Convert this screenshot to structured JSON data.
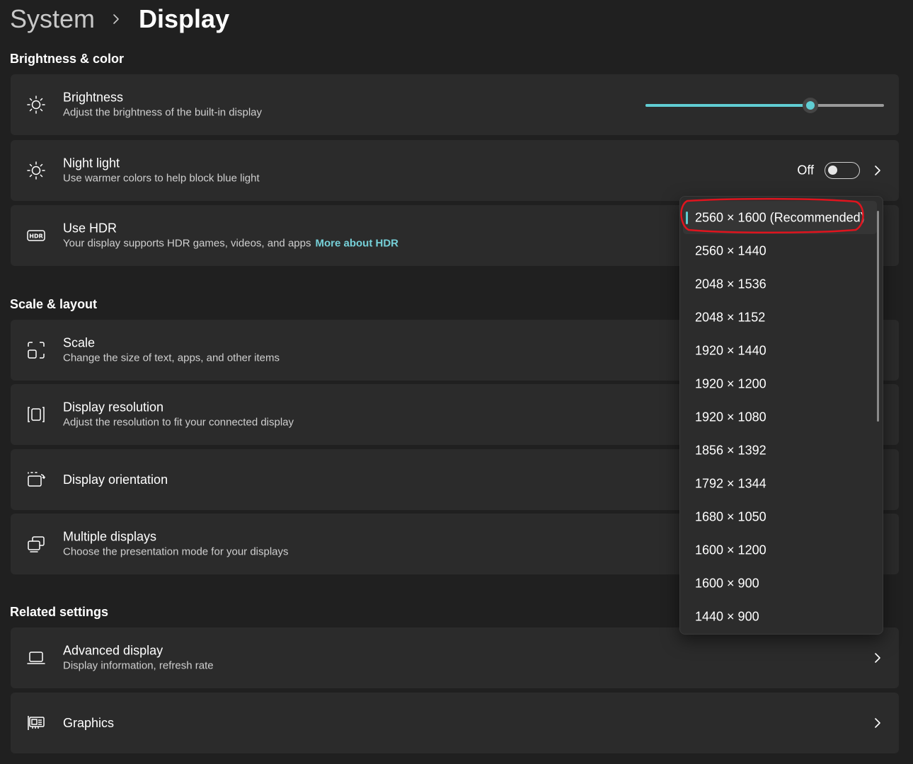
{
  "breadcrumb": {
    "parent": "System",
    "current": "Display"
  },
  "sections": {
    "brightness_color": "Brightness & color",
    "scale_layout": "Scale & layout",
    "related": "Related settings"
  },
  "brightness": {
    "title": "Brightness",
    "subtitle": "Adjust the brightness of the built-in display",
    "value_percent": 69
  },
  "night_light": {
    "title": "Night light",
    "subtitle": "Use warmer colors to help block blue light",
    "state": "Off"
  },
  "hdr": {
    "title": "Use HDR",
    "subtitle": "Your display supports HDR games, videos, and apps",
    "link": "More about HDR"
  },
  "scale": {
    "title": "Scale",
    "subtitle": "Change the size of text, apps, and other items"
  },
  "resolution": {
    "title": "Display resolution",
    "subtitle": "Adjust the resolution to fit your connected display"
  },
  "orientation": {
    "title": "Display orientation"
  },
  "multiple": {
    "title": "Multiple displays",
    "subtitle": "Choose the presentation mode for your displays"
  },
  "advanced": {
    "title": "Advanced display",
    "subtitle": "Display information, refresh rate"
  },
  "graphics": {
    "title": "Graphics"
  },
  "resolution_options": [
    "2560 × 1600 (Recommended)",
    "2560 × 1440",
    "2048 × 1536",
    "2048 × 1152",
    "1920 × 1440",
    "1920 × 1200",
    "1920 × 1080",
    "1856 × 1392",
    "1792 × 1344",
    "1680 × 1050",
    "1600 × 1200",
    "1600 × 900",
    "1440 × 900"
  ],
  "selected_index": 0,
  "colors": {
    "accent": "#60cdd3",
    "link": "#76d0d8",
    "annotation": "#e0141e",
    "background": "#202020",
    "card": "#2b2b2b"
  }
}
